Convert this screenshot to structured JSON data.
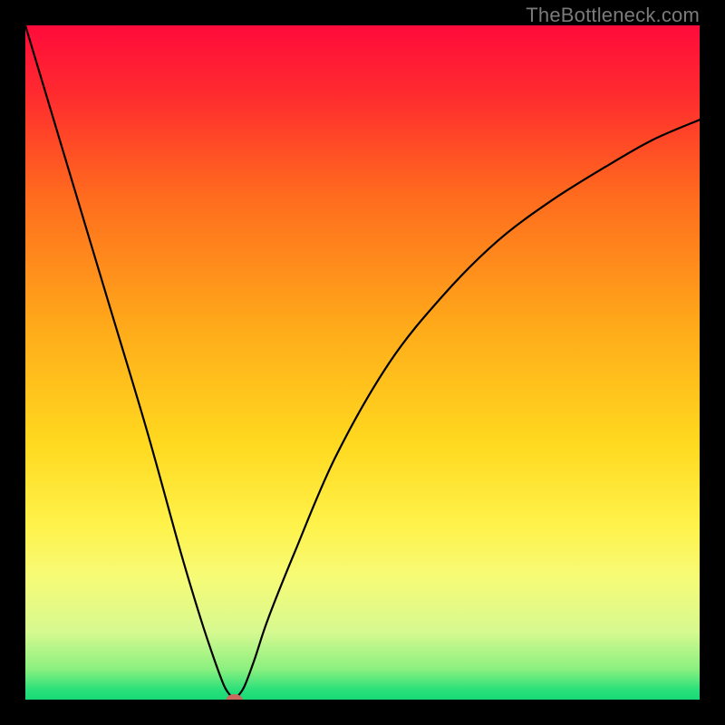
{
  "watermark": "TheBottleneck.com",
  "chart_data": {
    "type": "line",
    "title": "",
    "xlabel": "",
    "ylabel": "",
    "xlim": [
      0,
      100
    ],
    "ylim": [
      0,
      100
    ],
    "note": "Bottleneck curve: value 0 at the marker, rises steeply to the left edge and more gradually to the right. Axes are unlabeled; background is a red→orange→yellow→green vertical gradient representing bottleneck severity (top=worst, bottom=best).",
    "series": [
      {
        "name": "bottleneck",
        "x": [
          0,
          6,
          12,
          18,
          23,
          26,
          28,
          29.5,
          30.5,
          31,
          31.5,
          32.5,
          34,
          36,
          40,
          46,
          54,
          62,
          70,
          78,
          86,
          93,
          100
        ],
        "values": [
          100,
          80,
          60,
          40,
          22,
          12,
          6,
          2,
          0.5,
          0,
          0.5,
          2,
          6,
          12,
          22,
          36,
          50,
          60,
          68,
          74,
          79,
          83,
          86
        ]
      }
    ],
    "marker": {
      "x": 31,
      "y": 0,
      "color": "#c86b5e",
      "rx": 9,
      "ry": 6
    },
    "gradient_stops": [
      {
        "offset": 0.0,
        "color": "#ff0b3b"
      },
      {
        "offset": 0.1,
        "color": "#ff2a2f"
      },
      {
        "offset": 0.25,
        "color": "#ff6a1e"
      },
      {
        "offset": 0.45,
        "color": "#ffab1a"
      },
      {
        "offset": 0.62,
        "color": "#ffd91f"
      },
      {
        "offset": 0.74,
        "color": "#fff24a"
      },
      {
        "offset": 0.82,
        "color": "#f6fb77"
      },
      {
        "offset": 0.9,
        "color": "#d6f990"
      },
      {
        "offset": 0.955,
        "color": "#8af07f"
      },
      {
        "offset": 0.985,
        "color": "#2be07a"
      },
      {
        "offset": 1.0,
        "color": "#18d977"
      }
    ]
  }
}
